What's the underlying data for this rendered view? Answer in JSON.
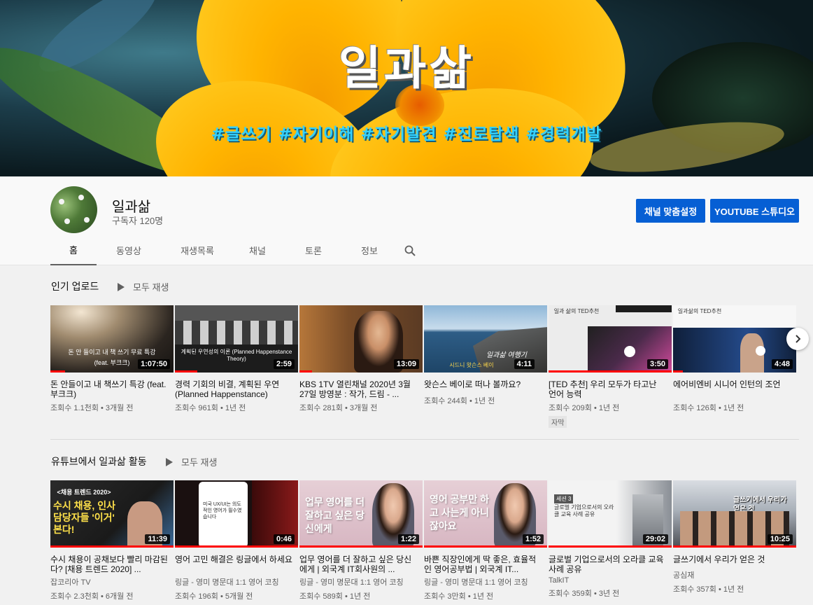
{
  "banner": {
    "title": "일과삶",
    "tags": "#글쓰기 #자기이해 #자기발견 #진로탐색 #경력개발"
  },
  "channel": {
    "name": "일과삶",
    "subscribers": "구독자 120명",
    "customize_label": "채널 맞춤설정",
    "studio_label": "YOUTUBE 스튜디오"
  },
  "tabs": [
    {
      "label": "홈",
      "active": true
    },
    {
      "label": "동영상",
      "active": false
    },
    {
      "label": "재생목록",
      "active": false
    },
    {
      "label": "채널",
      "active": false
    },
    {
      "label": "토론",
      "active": false
    },
    {
      "label": "정보",
      "active": false
    }
  ],
  "sections": [
    {
      "title": "인기 업로드",
      "play_all": "모두 재생",
      "videos": [
        {
          "title": "돈 안들이고 내 책쓰기 특강 (feat. 부크크)",
          "channel": "",
          "meta": "조회수 1.1천회 • 3개월 전",
          "duration": "1:07:50",
          "badge": "",
          "caption": "돈 안 들이고 내 책 쓰기 무료 특강",
          "caption2": "(feat. 부크크)"
        },
        {
          "title": "경력 기회의 비결, 계획된 우연 (Planned Happenstance)",
          "channel": "",
          "meta": "조회수 961회 • 1년 전",
          "duration": "2:59",
          "badge": "",
          "caption": "계획된 우연성의 이론 (Planned Happenstance Theory)",
          "caption2": ""
        },
        {
          "title": "KBS 1TV 열린채널 2020년 3월 27일 방영분 : 작가, 드림 - ...",
          "channel": "",
          "meta": "조회수 281회 • 3개월 전",
          "duration": "13:09",
          "badge": "",
          "caption": "",
          "caption2": ""
        },
        {
          "title": "왓슨스 베이로 떠나 볼까요?",
          "channel": "",
          "meta": "조회수 244회 • 1년 전",
          "duration": "4:11",
          "badge": "",
          "caption": "일과삶 여행기",
          "caption2": "시드니 왓슨스 베이"
        },
        {
          "title": "[TED 추천] 우리 모두가 타고난 언어 능력",
          "channel": "",
          "meta": "조회수 209회 • 1년 전",
          "duration": "3:50",
          "badge": "자막",
          "caption": "일과 삶의 TED추천",
          "caption2": ""
        },
        {
          "title": "에어비엔비 시니어 인턴의 조언",
          "channel": "",
          "meta": "조회수 126회 • 1년 전",
          "duration": "4:48",
          "badge": "",
          "caption": "일과삶의 TED추천",
          "caption2": ""
        }
      ]
    },
    {
      "title": "유튜브에서 일과삶 활동",
      "play_all": "모두 재생",
      "videos": [
        {
          "title": "수시 채용이 공채보다 빨리 마감된다? [채용 트렌드 2020] ...",
          "channel": "잡코리아 TV",
          "meta": "조회수 2.3천회 • 6개월 전",
          "duration": "11:39",
          "badge": "",
          "caption": "수시 채용, 인사담당자들 '이거' 본다!",
          "caption2": "<채용 트렌드 2020>"
        },
        {
          "title": "영어 고민 해결은 링글에서 하세요",
          "channel": "링글 - 영미 명문대 1:1 영어 코칭",
          "meta": "조회수 196회 • 5개월 전",
          "duration": "0:46",
          "badge": "",
          "caption": "미국 UX/UI는 의도적인 영어가 필수였습니다",
          "caption2": ""
        },
        {
          "title": "업무 영어를 더 잘하고 싶은 당신에게 | 외국계 IT회사원의 ...",
          "channel": "링글 - 영미 명문대 1:1 영어 코칭",
          "meta": "조회수 589회 • 1년 전",
          "duration": "1:22",
          "badge": "",
          "caption": "업무 영어를 더 잘하고 싶은 당신에게",
          "caption2": ""
        },
        {
          "title": "바쁜 직장인에게 딱 좋은, 효율적인 영어공부법 | 외국계 IT...",
          "channel": "링글 - 영미 명문대 1:1 영어 코칭",
          "meta": "조회수 3만회 • 1년 전",
          "duration": "1:52",
          "badge": "",
          "caption": "영어 공부만 하고 사는게 아니잖아요",
          "caption2": ""
        },
        {
          "title": "글로벌 기업으로서의 오라클 교육 사례 공유",
          "channel": "TalkIT",
          "meta": "조회수 359회 • 3년 전",
          "duration": "29:02",
          "badge": "",
          "caption": "세션 3",
          "caption2": "글로벌 기업으로서의 오라클 교육 사례 공유"
        },
        {
          "title": "글쓰기에서 우리가 얻은 것",
          "channel": "공심재",
          "meta": "조회수 357회 • 1년 전",
          "duration": "10:25",
          "badge": "",
          "caption": "글쓰기에서 우리가 얻은 것",
          "caption2": ""
        }
      ]
    }
  ],
  "colors": {
    "accent": "#065fd4",
    "progress": "#ff0000"
  }
}
